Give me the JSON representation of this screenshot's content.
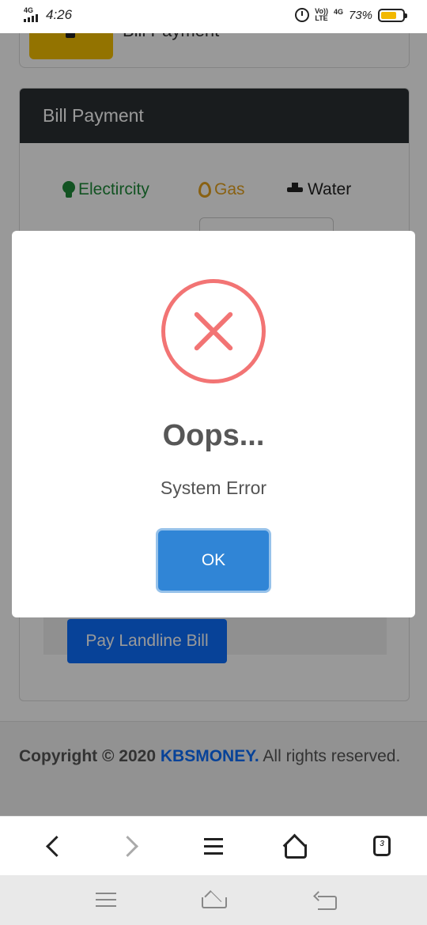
{
  "status_bar": {
    "network": "4G",
    "time": "4:26",
    "volte": "Vo))",
    "lte": "LTE",
    "network2": "4G",
    "battery_percent": "73%",
    "battery_level": 0.73
  },
  "previous_card": {
    "label": "Bill Payment"
  },
  "bill_card": {
    "header": "Bill Payment",
    "tabs": [
      {
        "label": "Electircity",
        "icon": "lightbulb-icon",
        "color": "#1f8a3a"
      },
      {
        "label": "Gas",
        "icon": "flame-icon",
        "color": "#e5a21e"
      },
      {
        "label": "Water",
        "icon": "faucet-icon",
        "color": "#222222"
      }
    ],
    "pay_button": "Pay Landline Bill"
  },
  "footer": {
    "copyright": "Copyright © 2020",
    "brand": "KBSMONEY.",
    "rights": "All rights reserved."
  },
  "dialog": {
    "icon": "error-x-icon",
    "title": "Oops...",
    "message": "System Error",
    "ok_label": "OK",
    "accent": "#3085d6",
    "error_color": "#f27474"
  },
  "browser_toolbar": {
    "tab_count": "3"
  }
}
